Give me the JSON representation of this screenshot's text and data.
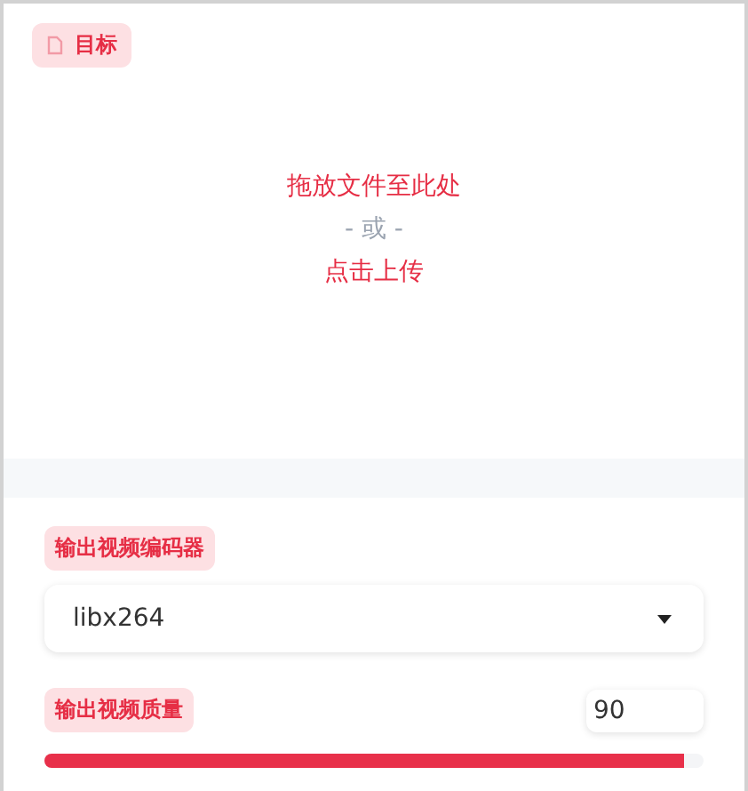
{
  "upload": {
    "label": "目标",
    "drop_text": "拖放文件至此处",
    "or_text": "- 或 -",
    "click_text": "点击上传"
  },
  "codec": {
    "label": "输出视频编码器",
    "value": "libx264"
  },
  "quality": {
    "label": "输出视频质量",
    "value": "90",
    "level": 0.97
  }
}
